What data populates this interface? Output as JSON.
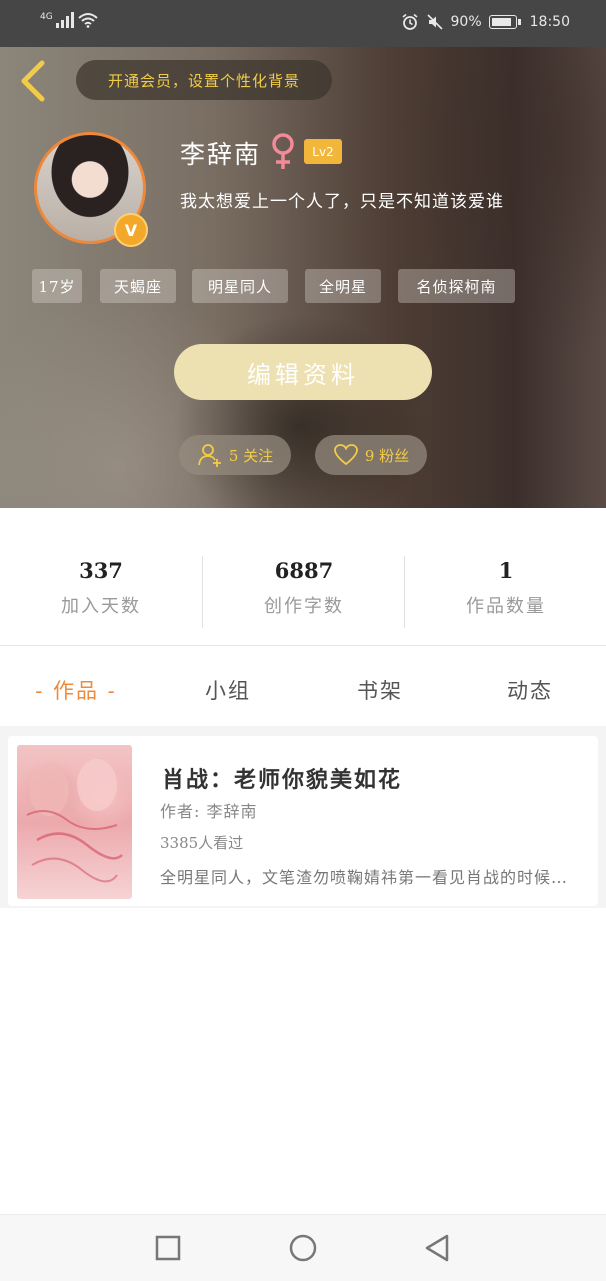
{
  "status_bar": {
    "network": "4G",
    "battery": "90%",
    "time": "18:50"
  },
  "header": {
    "vip_banner": "开通会员，设置个性化背景",
    "user_name": "李辞南",
    "level": "Lv2",
    "verified_badge": "V",
    "bio": "我太想爱上一个人了，只是不知道该爱谁",
    "tags": [
      "17岁",
      "天蝎座",
      "明星同人",
      "全明星",
      "名侦探柯南"
    ],
    "edit_button": "编辑资料",
    "following": "5 关注",
    "followers": "9 粉丝",
    "accent_color": "#f2cc48"
  },
  "stats": [
    {
      "value": "337",
      "label": "加入天数"
    },
    {
      "value": "6887",
      "label": "创作字数"
    },
    {
      "value": "1",
      "label": "作品数量"
    }
  ],
  "tabs": [
    {
      "label": "- 作品 -",
      "active": true
    },
    {
      "label": "小组",
      "active": false
    },
    {
      "label": "书架",
      "active": false
    },
    {
      "label": "动态",
      "active": false
    }
  ],
  "book": {
    "title": "肖战：老师你貌美如花",
    "author": "作者: 李辞南",
    "views": "3385人看过",
    "description": "全明星同人，文笔渣勿喷鞠婧祎第一看见肖战的时候就被他吸引了"
  },
  "nav": {
    "recent_icon": "square-icon",
    "home_icon": "circle-icon",
    "back_icon": "triangle-back-icon"
  }
}
